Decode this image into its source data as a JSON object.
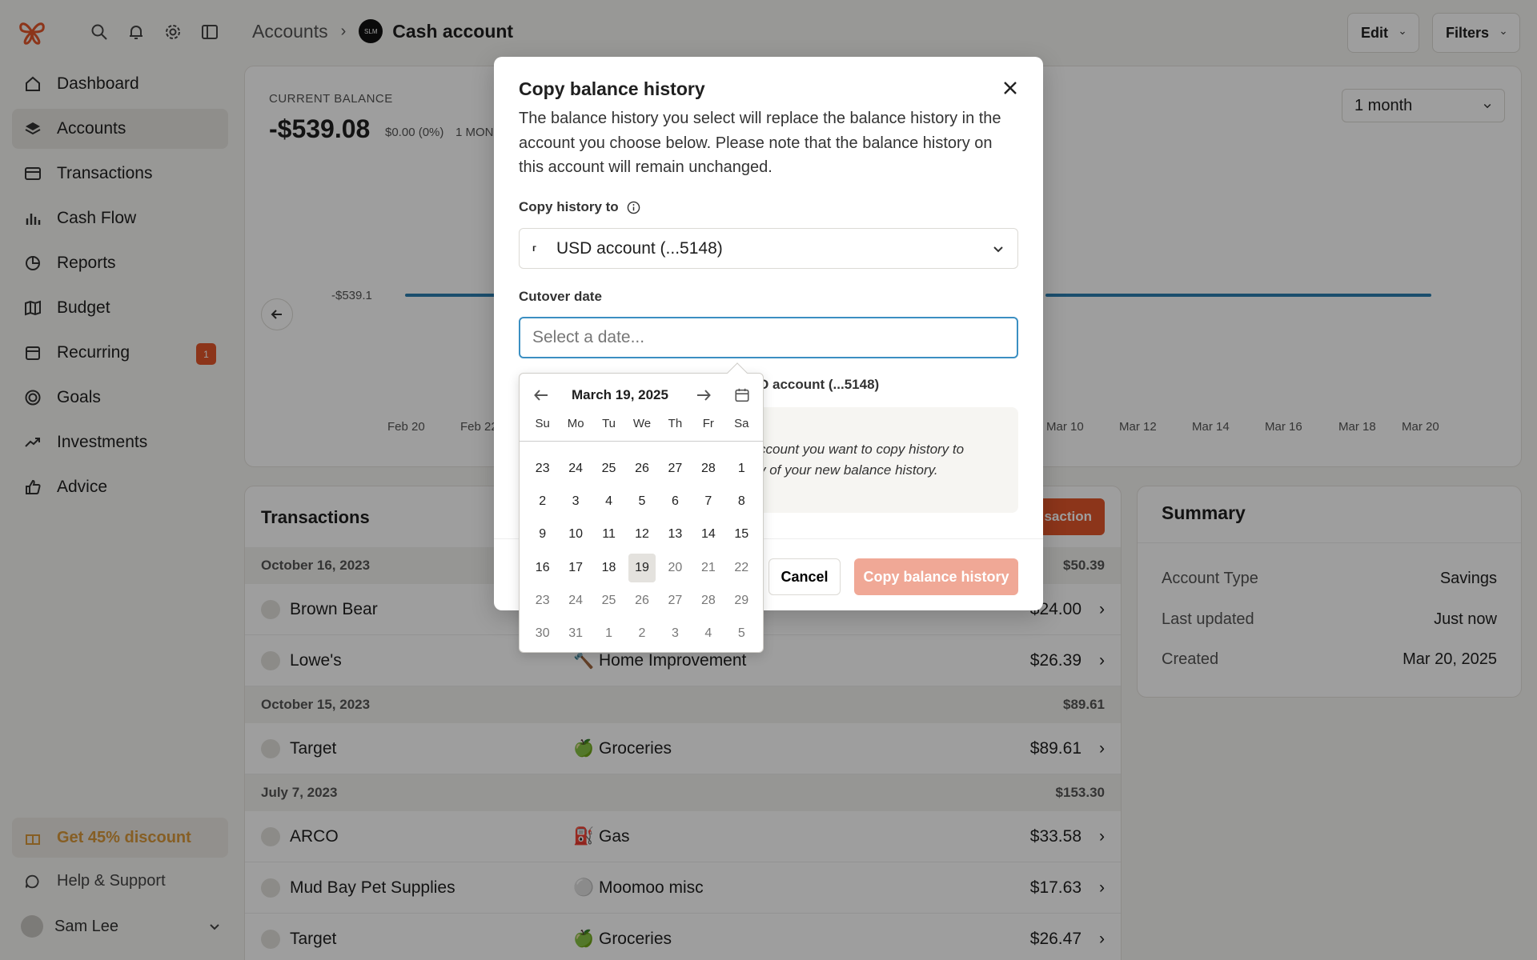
{
  "sidebar": {
    "items": [
      {
        "label": "Dashboard",
        "icon": "home-icon"
      },
      {
        "label": "Accounts",
        "icon": "layers-icon"
      },
      {
        "label": "Transactions",
        "icon": "card-icon"
      },
      {
        "label": "Cash Flow",
        "icon": "bar-chart-icon"
      },
      {
        "label": "Reports",
        "icon": "pie-icon"
      },
      {
        "label": "Budget",
        "icon": "map-icon"
      },
      {
        "label": "Recurring",
        "icon": "calendar-icon",
        "badge": "1"
      },
      {
        "label": "Goals",
        "icon": "target-icon"
      },
      {
        "label": "Investments",
        "icon": "trend-icon"
      },
      {
        "label": "Advice",
        "icon": "thumbs-up-icon"
      }
    ],
    "promo": "Get 45% discount",
    "help": "Help & Support",
    "user": "Sam Lee"
  },
  "header": {
    "breadcrumb_parent": "Accounts",
    "breadcrumb_logo": "SLM",
    "breadcrumb_current": "Cash account",
    "edit_label": "Edit",
    "filters_label": "Filters"
  },
  "balance": {
    "label": "CURRENT BALANCE",
    "value": "-$539.08",
    "change": "$0.00 (0%)",
    "period": "1 MON",
    "range": "1 month",
    "y_label": "-$539.1",
    "x_ticks": [
      "Feb 20",
      "Feb 22",
      "Mar 10",
      "Mar 12",
      "Mar 14",
      "Mar 16",
      "Mar 18",
      "Mar 20"
    ]
  },
  "transactions": {
    "title": "Transactions",
    "add_label": "saction",
    "groups": [
      {
        "date": "October 16, 2023",
        "total": "$50.39",
        "rows": [
          {
            "merchant": "Brown Bear",
            "category": "",
            "amount": "$24.00"
          },
          {
            "merchant": "Lowe's",
            "category": "🔨 Home Improvement",
            "amount": "$26.39"
          }
        ]
      },
      {
        "date": "October 15, 2023",
        "total": "$89.61",
        "rows": [
          {
            "merchant": "Target",
            "category": "🍏 Groceries",
            "amount": "$89.61"
          }
        ]
      },
      {
        "date": "July 7, 2023",
        "total": "$153.30",
        "rows": [
          {
            "merchant": "ARCO",
            "category": "⛽ Gas",
            "amount": "$33.58"
          },
          {
            "merchant": "Mud Bay Pet Supplies",
            "category": "⚪ Moomoo misc",
            "amount": "$17.63"
          },
          {
            "merchant": "Target",
            "category": "🍏 Groceries",
            "amount": "$26.47"
          }
        ]
      }
    ]
  },
  "summary": {
    "title": "Summary",
    "rows": [
      {
        "key": "Account Type",
        "value": "Savings"
      },
      {
        "key": "Last updated",
        "value": "Just now"
      },
      {
        "key": "Created",
        "value": "Mar 20, 2025"
      }
    ]
  },
  "modal": {
    "title": "Copy balance history",
    "description": "The balance history you select will replace the balance history in the account you choose below. Please note that the balance history on this account will remain unchanged.",
    "copy_to_label": "Copy history to",
    "copy_to_value": "USD account (...5148)",
    "cutover_label": "Cutover date",
    "cutover_placeholder": "Select a date...",
    "preview_label_partial": "D account (...5148)",
    "note_line1": "ccount you want to copy history to",
    "note_line2": "y of your new balance history.",
    "cancel_label": "Cancel",
    "copy_label": "Copy balance history"
  },
  "calendar": {
    "title": "March 19, 2025",
    "dows": [
      "Su",
      "Mo",
      "Tu",
      "We",
      "Th",
      "Fr",
      "Sa"
    ],
    "days": [
      {
        "d": "23",
        "muted": false
      },
      {
        "d": "24",
        "muted": false
      },
      {
        "d": "25",
        "muted": false
      },
      {
        "d": "26",
        "muted": false
      },
      {
        "d": "27",
        "muted": false
      },
      {
        "d": "28",
        "muted": false
      },
      {
        "d": "1",
        "muted": false
      },
      {
        "d": "2",
        "muted": false
      },
      {
        "d": "3",
        "muted": false
      },
      {
        "d": "4",
        "muted": false
      },
      {
        "d": "5",
        "muted": false
      },
      {
        "d": "6",
        "muted": false
      },
      {
        "d": "7",
        "muted": false
      },
      {
        "d": "8",
        "muted": false
      },
      {
        "d": "9",
        "muted": false
      },
      {
        "d": "10",
        "muted": false
      },
      {
        "d": "11",
        "muted": false
      },
      {
        "d": "12",
        "muted": false
      },
      {
        "d": "13",
        "muted": false
      },
      {
        "d": "14",
        "muted": false
      },
      {
        "d": "15",
        "muted": false
      },
      {
        "d": "16",
        "muted": false
      },
      {
        "d": "17",
        "muted": false
      },
      {
        "d": "18",
        "muted": false
      },
      {
        "d": "19",
        "muted": false,
        "today": true
      },
      {
        "d": "20",
        "muted": true
      },
      {
        "d": "21",
        "muted": true
      },
      {
        "d": "22",
        "muted": true
      },
      {
        "d": "23",
        "muted": true
      },
      {
        "d": "24",
        "muted": true
      },
      {
        "d": "25",
        "muted": true
      },
      {
        "d": "26",
        "muted": true
      },
      {
        "d": "27",
        "muted": true
      },
      {
        "d": "28",
        "muted": true
      },
      {
        "d": "29",
        "muted": true
      },
      {
        "d": "30",
        "muted": true
      },
      {
        "d": "31",
        "muted": true
      },
      {
        "d": "1",
        "muted": true
      },
      {
        "d": "2",
        "muted": true
      },
      {
        "d": "3",
        "muted": true
      },
      {
        "d": "4",
        "muted": true
      },
      {
        "d": "5",
        "muted": true
      }
    ]
  },
  "colors": {
    "accent": "#e3562b",
    "focus": "#3b8fc2",
    "chart_line": "#2c7fb0"
  }
}
